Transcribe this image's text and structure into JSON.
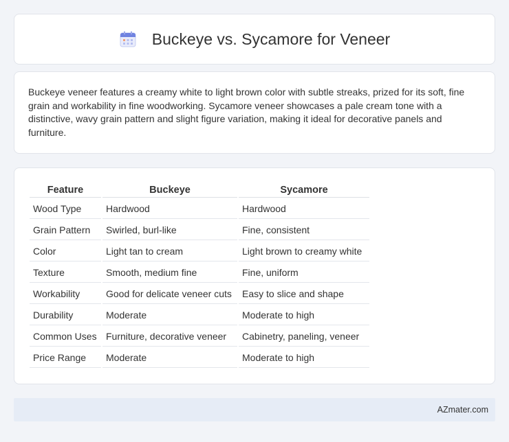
{
  "header": {
    "title": "Buckeye vs. Sycamore for Veneer",
    "icon": "calendar-icon"
  },
  "description": {
    "text": "Buckeye veneer features a creamy white to light brown color with subtle streaks, prized for its soft, fine grain and workability in fine woodworking. Sycamore veneer showcases a pale cream tone with a distinctive, wavy grain pattern and slight figure variation, making it ideal for decorative panels and furniture."
  },
  "table": {
    "headers": [
      "Feature",
      "Buckeye",
      "Sycamore"
    ],
    "rows": [
      [
        "Wood Type",
        "Hardwood",
        "Hardwood"
      ],
      [
        "Grain Pattern",
        "Swirled, burl-like",
        "Fine, consistent"
      ],
      [
        "Color",
        "Light tan to cream",
        "Light brown to creamy white"
      ],
      [
        "Texture",
        "Smooth, medium fine",
        "Fine, uniform"
      ],
      [
        "Workability",
        "Good for delicate veneer cuts",
        "Easy to slice and shape"
      ],
      [
        "Durability",
        "Moderate",
        "Moderate to high"
      ],
      [
        "Common Uses",
        "Furniture, decorative veneer",
        "Cabinetry, paneling, veneer"
      ],
      [
        "Price Range",
        "Moderate",
        "Moderate to high"
      ]
    ]
  },
  "footer": {
    "site": "AZmater.com"
  },
  "colors": {
    "background": "#f2f4f8",
    "card": "#ffffff",
    "footer_bg": "#e6ecf6",
    "icon_accent": "#5b6fd6"
  }
}
